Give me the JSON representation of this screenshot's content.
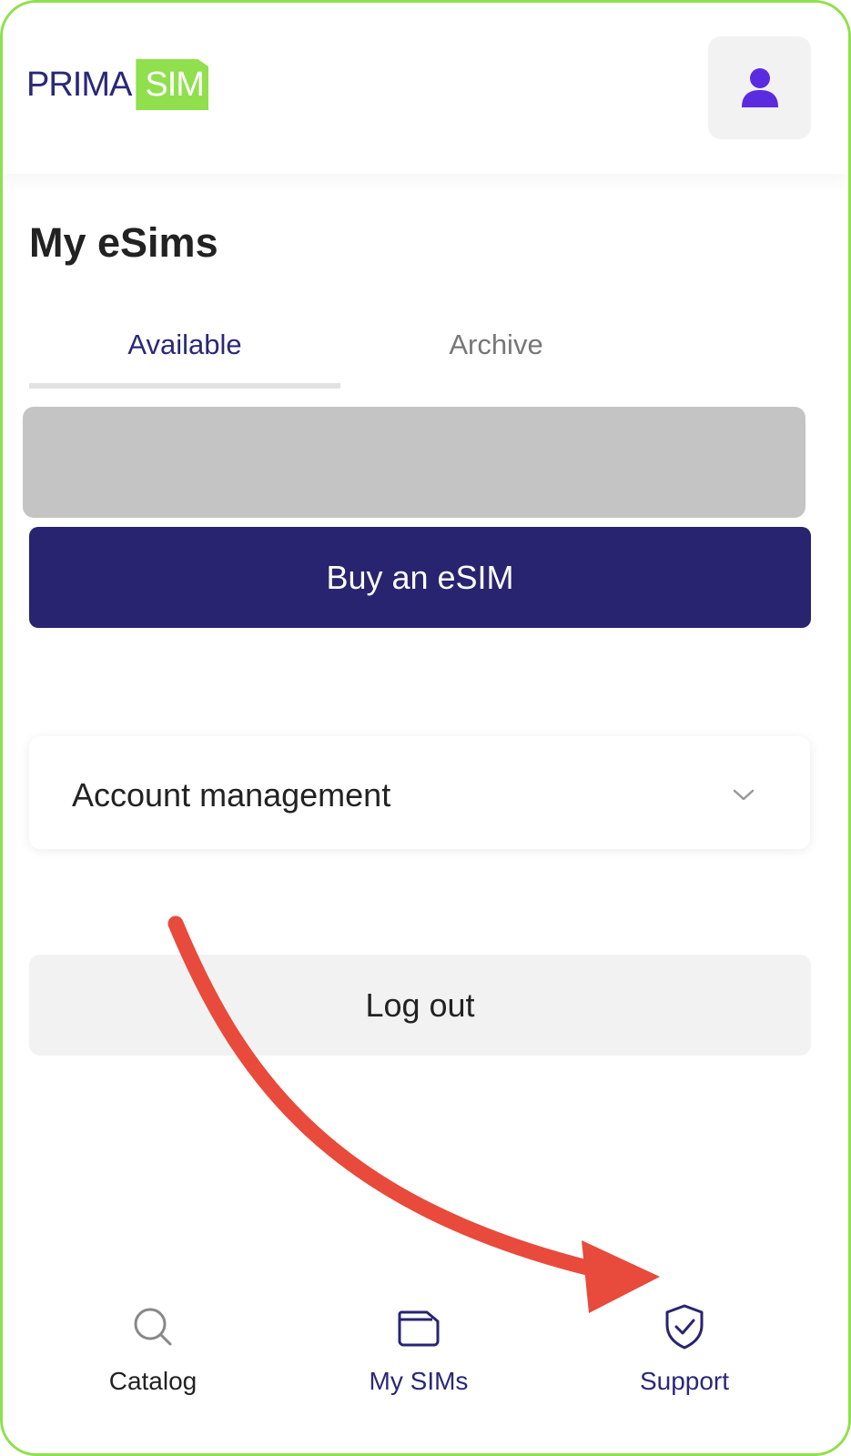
{
  "header": {
    "logo_text_1": "PRIMA",
    "logo_text_2": "SIM"
  },
  "page": {
    "title": "My eSims"
  },
  "tabs": [
    {
      "label": "Available"
    },
    {
      "label": "Archive"
    }
  ],
  "buttons": {
    "buy": "Buy an eSIM",
    "logout": "Log out"
  },
  "account": {
    "label": "Account management"
  },
  "nav": {
    "items": [
      {
        "label": "Catalog",
        "icon": "search-icon"
      },
      {
        "label": "My SIMs",
        "icon": "sim-card-icon"
      },
      {
        "label": "Support",
        "icon": "shield-check-icon"
      }
    ]
  },
  "colors": {
    "brand_navy": "#28246f",
    "brand_green": "#8fe04c",
    "profile_icon": "#5b2be0",
    "arrow": "#e84a3c"
  }
}
